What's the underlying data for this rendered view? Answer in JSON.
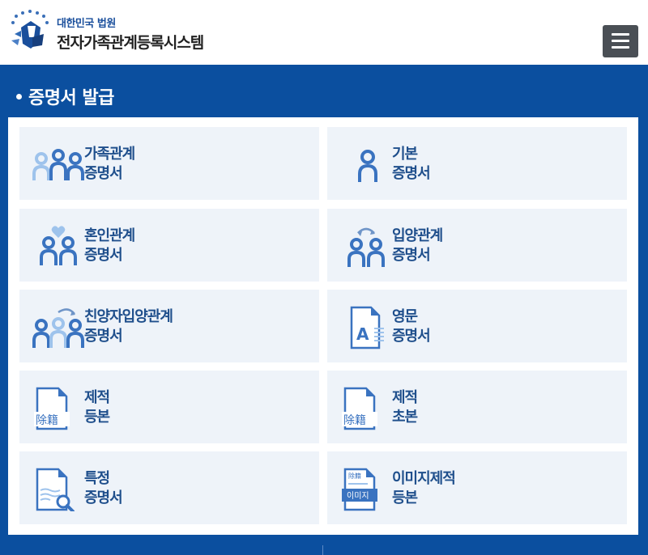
{
  "header": {
    "court_name": "대한민국 법원",
    "system_name": "전자가족관계등록시스템",
    "menu_icon": "hamburger-menu-icon"
  },
  "section": {
    "title": "증명서 발급"
  },
  "cards": [
    {
      "id": "family-relation",
      "line1": "가족관계",
      "line2": "증명서",
      "icon": "three-people-icon"
    },
    {
      "id": "basic",
      "line1": "기본",
      "line2": "증명서",
      "icon": "single-person-icon"
    },
    {
      "id": "marriage-relation",
      "line1": "혼인관계",
      "line2": "증명서",
      "icon": "couple-heart-icon"
    },
    {
      "id": "adoption-relation",
      "line1": "입양관계",
      "line2": "증명서",
      "icon": "two-people-exchange-icon"
    },
    {
      "id": "full-adoption-relation",
      "line1": "친양자입양관계",
      "line2": "증명서",
      "icon": "three-people-exchange-icon"
    },
    {
      "id": "english",
      "line1": "영문",
      "line2": "증명서",
      "icon": "english-document-icon"
    },
    {
      "id": "removed-register-full",
      "line1": "제적",
      "line2": "등본",
      "icon": "removed-register-document-icon",
      "doc_text": "除籍"
    },
    {
      "id": "removed-register-excerpt",
      "line1": "제적",
      "line2": "초본",
      "icon": "removed-register-document-icon",
      "doc_text": "除籍"
    },
    {
      "id": "specific",
      "line1": "특정",
      "line2": "증명서",
      "icon": "document-search-icon"
    },
    {
      "id": "image-removed-register",
      "line1": "이미지제적",
      "line2": "등본",
      "icon": "image-document-icon",
      "doc_top": "除籍",
      "doc_text": "이미지"
    }
  ],
  "colors": {
    "brand_blue": "#0b4f9f",
    "card_bg": "#eef3f9",
    "label_text": "#1f4f8c",
    "icon_blue": "#3a73c0",
    "icon_light": "#9ec3ec"
  }
}
